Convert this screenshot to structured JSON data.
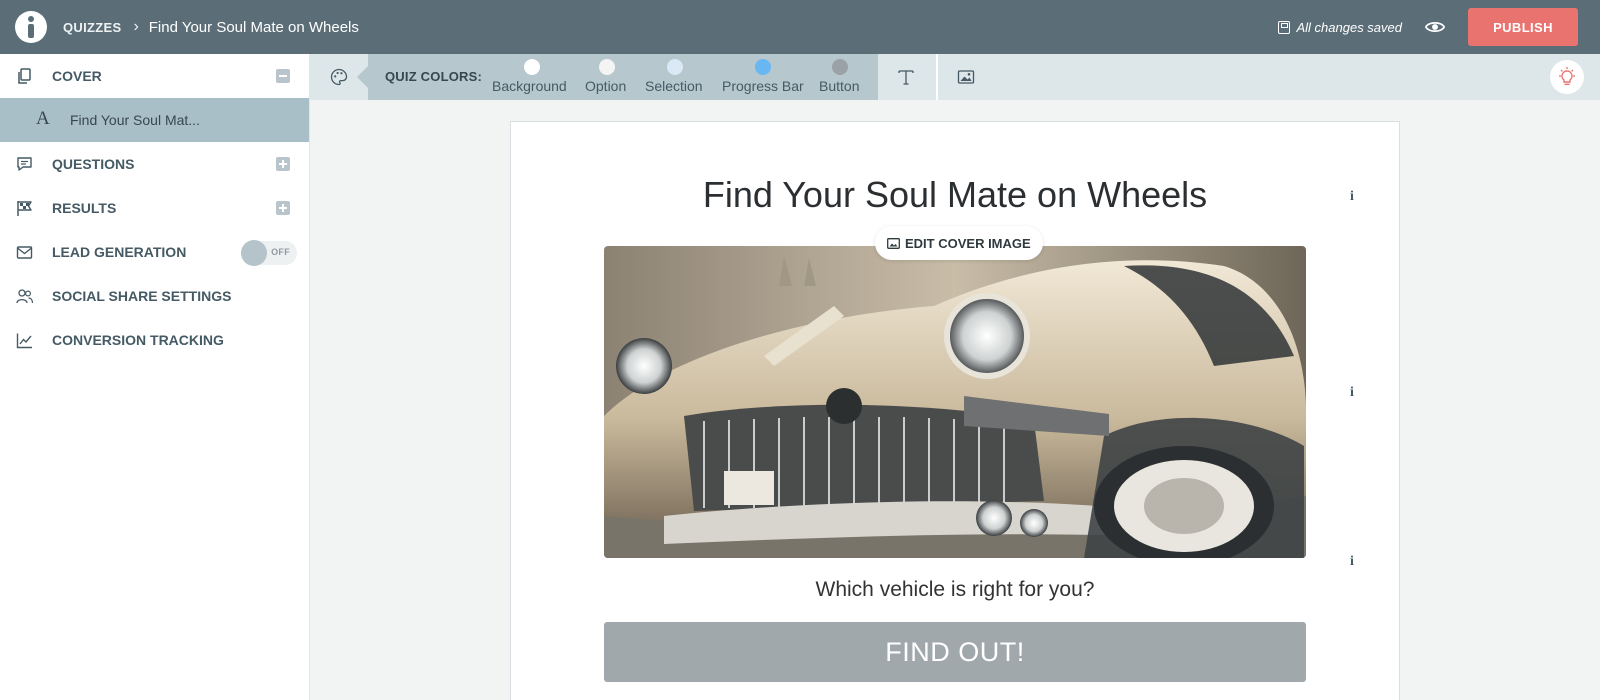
{
  "header": {
    "breadcrumb_root": "QUIZZES",
    "quiz_title": "Find Your Soul Mate on Wheels",
    "save_status": "All changes saved",
    "publish_label": "PUBLISH",
    "publish_color": "#e8736f",
    "bar_color": "#5b6e77"
  },
  "sidebar": {
    "cover_label": "COVER",
    "cover_item_label": "Find Your Soul Mat...",
    "questions_label": "QUESTIONS",
    "results_label": "RESULTS",
    "lead_generation_label": "LEAD GENERATION",
    "lead_toggle_state": "OFF",
    "social_label": "SOCIAL SHARE SETTINGS",
    "conversion_label": "CONVERSION TRACKING",
    "selected_bg": "#a9bfc8"
  },
  "toolbar": {
    "quiz_colors_label": "QUIZ COLORS:",
    "swatches": [
      {
        "label": "Background",
        "color": "#ffffff"
      },
      {
        "label": "Option",
        "color": "#f4f4f4"
      },
      {
        "label": "Selection",
        "color": "#dbe9f6"
      },
      {
        "label": "Progress Bar",
        "color": "#68b6f2"
      },
      {
        "label": "Button",
        "color": "#9aa2a6"
      }
    ],
    "icons": [
      "palette-icon",
      "text-icon",
      "image-icon",
      "lightbulb-icon"
    ]
  },
  "cover_card": {
    "title": "Find Your Soul Mate on Wheels",
    "edit_cover_label": "EDIT COVER IMAGE",
    "cover_image": "vintage cream classic car (Cadillac) sepia photo",
    "subtitle": "Which vehicle is right for you?",
    "cta_label": "FIND OUT!",
    "cta_color": "#a1a8ac"
  }
}
